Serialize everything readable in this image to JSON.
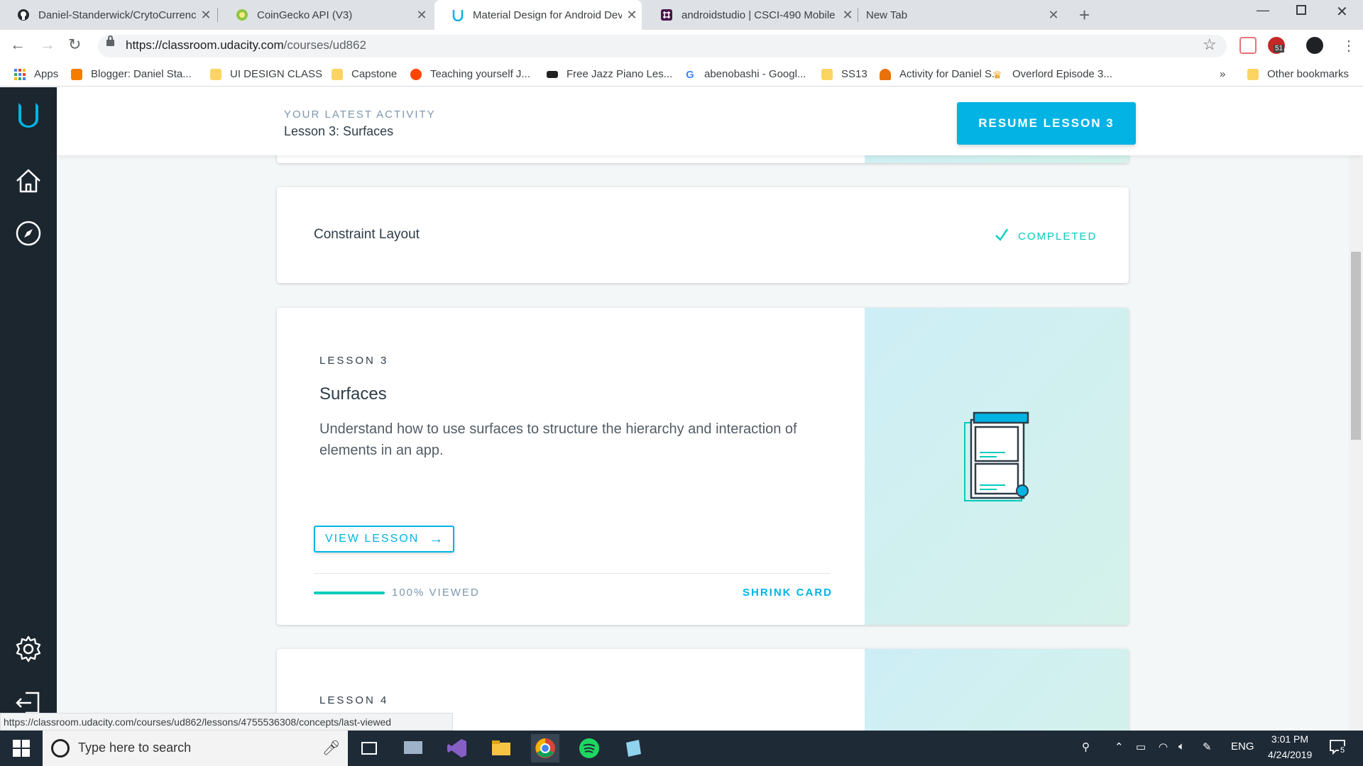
{
  "browser": {
    "tabs": [
      {
        "title": "Daniel-Standerwick/CrytoCurrenc",
        "icon": "github-icon",
        "active": false
      },
      {
        "title": "CoinGecko API (V3)",
        "icon": "coingecko-icon",
        "active": false
      },
      {
        "title": "Material Design for Android Deve",
        "icon": "udacity-icon",
        "active": true
      },
      {
        "title": "androidstudio | CSCI-490 Mobile",
        "icon": "slack-icon",
        "active": false
      },
      {
        "title": "New Tab",
        "icon": "",
        "active": false
      }
    ],
    "url_host": "https://classroom.udacity.com",
    "url_path": "/courses/ud862",
    "extension_badge": "51",
    "bookmarks": [
      {
        "label": "Apps",
        "icon": "apps-grid-icon"
      },
      {
        "label": "Blogger: Daniel Sta...",
        "icon": "blogger-icon"
      },
      {
        "label": "UI DESIGN CLASS",
        "icon": "folder-icon"
      },
      {
        "label": "Capstone",
        "icon": "folder-icon"
      },
      {
        "label": "Teaching yourself J...",
        "icon": "reddit-icon"
      },
      {
        "label": "Free Jazz Piano Les...",
        "icon": "piano-icon"
      },
      {
        "label": "abenobashi - Googl...",
        "icon": "google-icon"
      },
      {
        "label": "SS13",
        "icon": "folder-icon"
      },
      {
        "label": "Activity for Daniel S...",
        "icon": "person-icon"
      },
      {
        "label": "Overlord Episode 3...",
        "icon": "crown-icon"
      }
    ],
    "bookmarks_overflow": "»",
    "other_bookmarks": "Other bookmarks",
    "status_url": "https://classroom.udacity.com/courses/ud862/lessons/4755536308/concepts/last-viewed"
  },
  "activity": {
    "label": "YOUR LATEST ACTIVITY",
    "lesson": "Lesson 3: Surfaces",
    "resume_button": "RESUME LESSON 3"
  },
  "cards": {
    "constraint": {
      "title": "Constraint Layout",
      "status": "COMPLETED"
    },
    "lesson3": {
      "number": "LESSON 3",
      "title": "Surfaces",
      "description": "Understand how to use surfaces to structure the hierarchy and interaction of elements in an app.",
      "view_button": "VIEW LESSON",
      "progress_percent": 100,
      "progress_text": "100% VIEWED",
      "shrink": "SHRINK CARD"
    },
    "lesson4": {
      "number": "LESSON 4"
    }
  },
  "colors": {
    "accent": "#02b3e4",
    "completed": "#02ccba",
    "sidebar": "#1c262f",
    "text": "#2e3d49"
  },
  "taskbar": {
    "search_placeholder": "Type here to search",
    "language": "ENG",
    "time": "3:01 PM",
    "date": "4/24/2019",
    "notification_count": "5"
  }
}
